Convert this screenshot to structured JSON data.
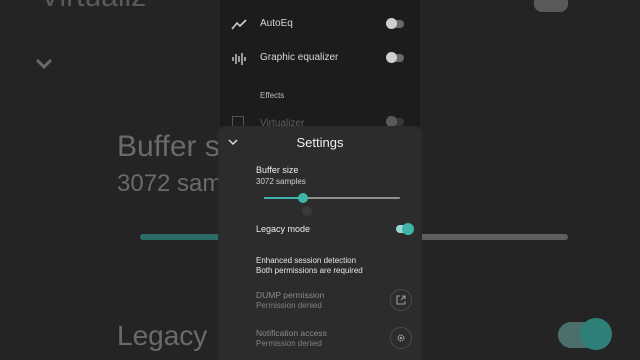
{
  "background": {
    "top_text": "Virtualiz",
    "buffer_label": "Buffer si",
    "buffer_value": "3072 sam",
    "legacy_label": "Legacy"
  },
  "list": {
    "items": [
      {
        "label": "AutoEq",
        "icon": "trend-line-icon",
        "enabled": false
      },
      {
        "label": "Graphic equalizer",
        "icon": "waveform-icon",
        "enabled": false
      }
    ],
    "section_header": "Effects",
    "dimmed_item": {
      "label": "Virtualizer",
      "enabled": false
    }
  },
  "sheet": {
    "title": "Settings",
    "buffer_size": {
      "label": "Buffer size",
      "value": "3072 samples",
      "slider_fraction": 0.29
    },
    "legacy_mode": {
      "label": "Legacy mode",
      "enabled": true
    },
    "enhanced_session": {
      "title": "Enhanced session detection",
      "subtitle": "Both permissions are required"
    },
    "permissions": [
      {
        "title": "DUMP permission",
        "status": "Permission denied",
        "icon": "open-external-icon"
      },
      {
        "title": "Notification access",
        "status": "Permission denied",
        "icon": "gear-icon"
      }
    ]
  },
  "colors": {
    "accent": "#3fb5aa",
    "sheet_bg": "#2c2c2c",
    "page_bg": "#1c1c1c"
  }
}
